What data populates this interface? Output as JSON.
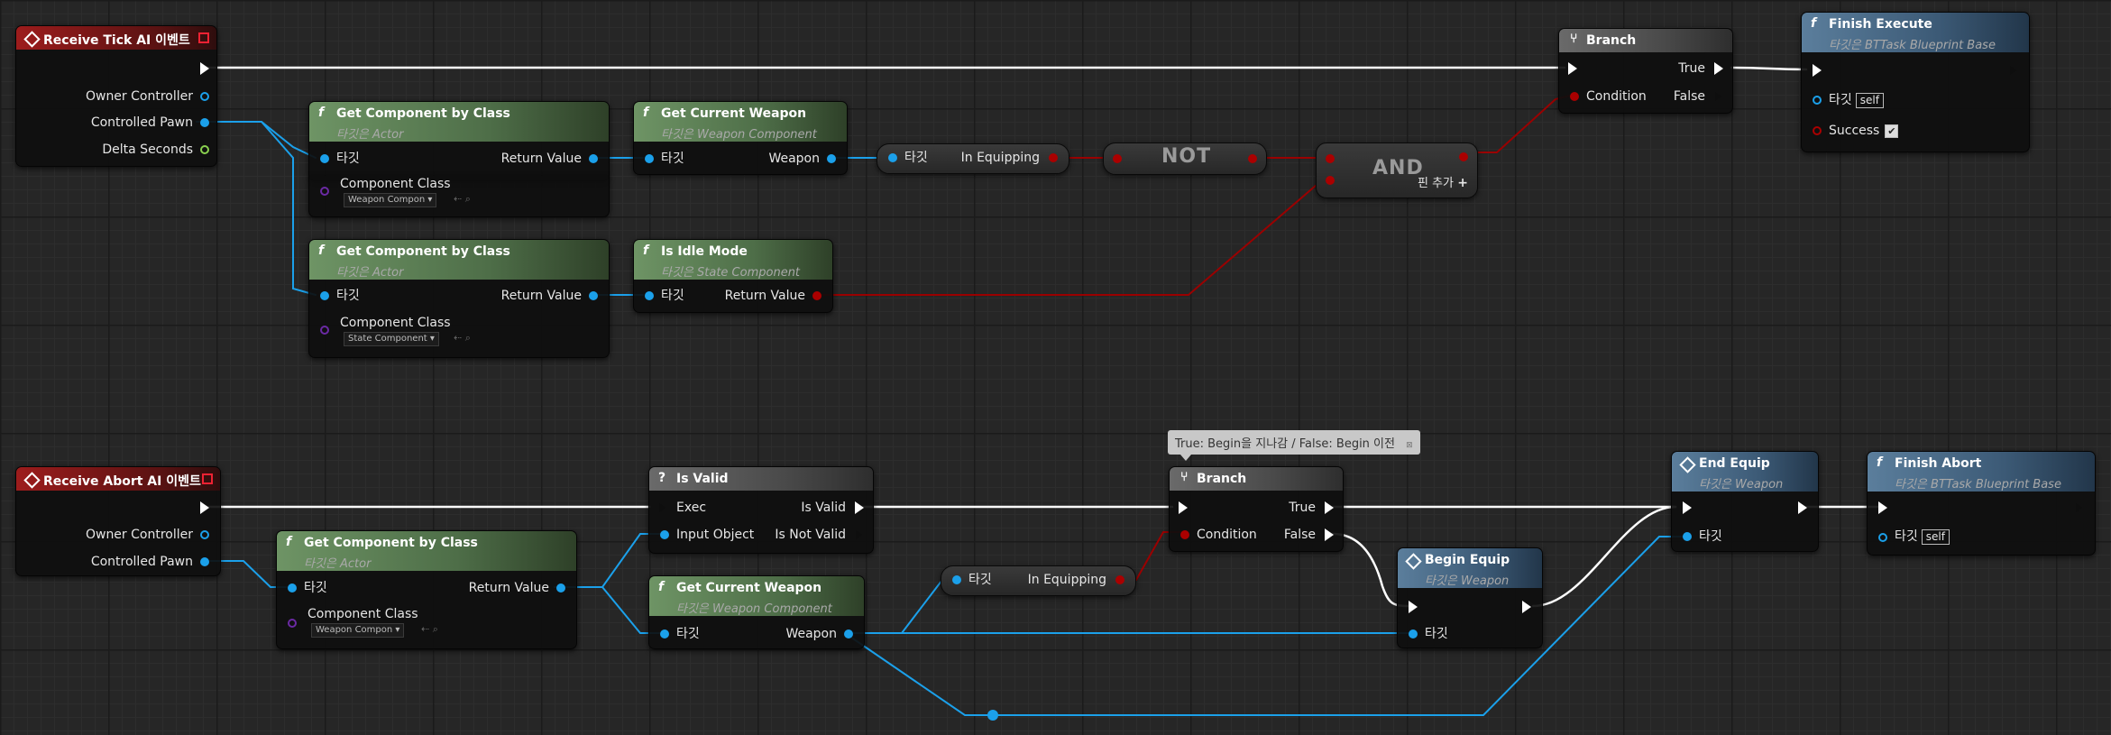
{
  "tick_event": {
    "title": "Receive Tick AI 이벤트",
    "owner_controller": "Owner Controller",
    "controlled_pawn": "Controlled Pawn",
    "delta_seconds": "Delta Seconds"
  },
  "get_comp_1": {
    "title": "Get Component by Class",
    "target_note": "타깃은 Actor",
    "target": "타깃",
    "component_class": "Component Class",
    "class_value": "Weapon Compon",
    "return_value": "Return Value"
  },
  "get_comp_2": {
    "title": "Get Component by Class",
    "target_note": "타깃은 Actor",
    "target": "타깃",
    "component_class": "Component Class",
    "class_value": "State Component",
    "return_value": "Return Value"
  },
  "get_weapon_1": {
    "title": "Get Current Weapon",
    "target_note": "타깃은 Weapon Component",
    "target": "타깃",
    "weapon": "Weapon"
  },
  "is_idle": {
    "title": "Is Idle Mode",
    "target_note": "타깃은 State Component",
    "target": "타깃",
    "return_value": "Return Value"
  },
  "in_equipping_1": {
    "target": "타깃",
    "label": "In Equipping"
  },
  "not_node": {
    "label": "NOT"
  },
  "and_node": {
    "label": "AND",
    "add_pin": "핀 추가"
  },
  "branch_1": {
    "title": "Branch",
    "condition": "Condition",
    "true_label": "True",
    "false_label": "False"
  },
  "finish_execute": {
    "title": "Finish Execute",
    "target_note": "타깃은 BTTask Blueprint Base",
    "target": "타깃",
    "self": "self",
    "success": "Success"
  },
  "abort_event": {
    "title": "Receive Abort AI 이벤트",
    "owner_controller": "Owner Controller",
    "controlled_pawn": "Controlled Pawn"
  },
  "get_comp_3": {
    "title": "Get Component by Class",
    "target_note": "타깃은 Actor",
    "target": "타깃",
    "component_class": "Component Class",
    "class_value": "Weapon Compon",
    "return_value": "Return Value"
  },
  "is_valid": {
    "title": "Is Valid",
    "exec": "Exec",
    "input_object": "Input Object",
    "is_valid": "Is Valid",
    "is_not_valid": "Is Not Valid"
  },
  "get_weapon_2": {
    "title": "Get Current Weapon",
    "target_note": "타깃은 Weapon Component",
    "target": "타깃",
    "weapon": "Weapon"
  },
  "in_equipping_2": {
    "target": "타깃",
    "label": "In Equipping"
  },
  "comment": {
    "text": "True: Begin을 지나감 / False: Begin 이전"
  },
  "branch_2": {
    "title": "Branch",
    "condition": "Condition",
    "true_label": "True",
    "false_label": "False"
  },
  "begin_equip": {
    "title": "Begin Equip",
    "target_note": "타깃은 Weapon",
    "target": "타깃"
  },
  "end_equip": {
    "title": "End Equip",
    "target_note": "타깃은 Weapon",
    "target": "타깃"
  },
  "finish_abort": {
    "title": "Finish Abort",
    "target_note": "타깃은 BTTask Blueprint Base",
    "target": "타깃",
    "self": "self"
  },
  "colors": {
    "exec": "#ffffff",
    "object": "#1ba0ea",
    "bool": "#9a0000",
    "float": "#8ad04f",
    "class": "#6b2aa4",
    "event_header": "#9d1c1c",
    "function_header": "#6e9465",
    "message_header": "#5b7e9c"
  }
}
